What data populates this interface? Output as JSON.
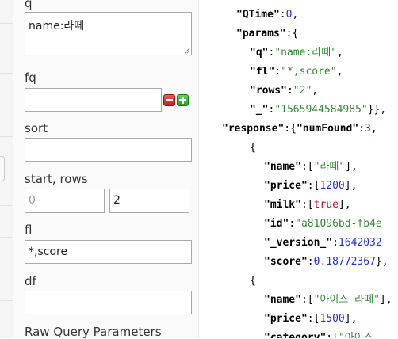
{
  "form": {
    "q": {
      "label": "q",
      "value": "name:라떼"
    },
    "fq": {
      "label": "fq",
      "value": ""
    },
    "sort": {
      "label": "sort",
      "value": ""
    },
    "start_rows": {
      "label": "start, rows",
      "start_placeholder": "0",
      "rows_value": "2"
    },
    "fl": {
      "label": "fl",
      "value": "*,score"
    },
    "df": {
      "label": "df",
      "value": ""
    },
    "raw": {
      "label": "Raw Query Parameters"
    }
  },
  "json": {
    "qtime_key": "\"QTime\"",
    "qtime_value": "0",
    "params_key": "\"params\"",
    "q_key": "\"q\"",
    "q_value": "\"name:라떼\"",
    "fl_key": "\"fl\"",
    "fl_value": "\"*,score\"",
    "rows_key": "\"rows\"",
    "rows_value": "\"2\"",
    "underscore_key": "\"_\"",
    "underscore_value": "\"1565944584985\"",
    "response_key": "\"response\"",
    "numfound_key": "\"numFound\"",
    "numfound_value": "3",
    "doc1": {
      "name_key": "\"name\"",
      "name_value": "\"라떼\"",
      "price_key": "\"price\"",
      "price_value": "1200",
      "milk_key": "\"milk\"",
      "milk_value": "true",
      "id_key": "\"id\"",
      "id_value": "\"a81096bd-fb4e",
      "version_key": "\"_version_\"",
      "version_value": "1642032",
      "score_key": "\"score\"",
      "score_value": "0.18772367"
    },
    "doc2": {
      "name_key": "\"name\"",
      "name_value": "\"아이스 라떼\"",
      "price_key": "\"price\"",
      "price_value": "1500",
      "category_key": "\"category\"",
      "category_value": "\"아이스"
    }
  }
}
